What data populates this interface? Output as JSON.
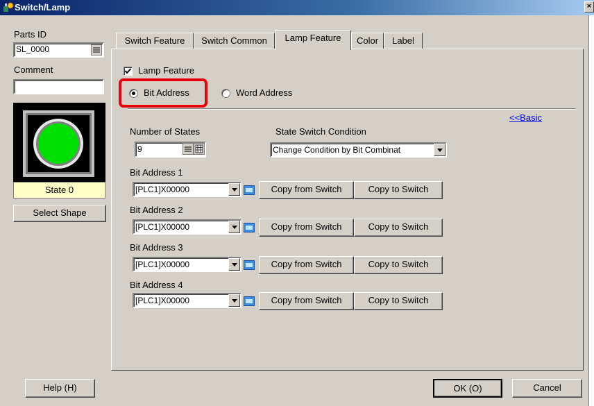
{
  "window": {
    "title": "Switch/Lamp",
    "close_label": "×"
  },
  "left": {
    "parts_id_label": "Parts ID",
    "parts_id_value": "SL_0000",
    "comment_label": "Comment",
    "comment_value": "",
    "state_label": "State 0",
    "select_shape_label": "Select Shape",
    "help_label": "Help (H)"
  },
  "tabs": [
    "Switch Feature",
    "Switch Common",
    "Lamp Feature",
    "Color",
    "Label"
  ],
  "lamp": {
    "lamp_feature_label": "Lamp Feature",
    "bit_address_label": "Bit Address",
    "word_address_label": "Word Address",
    "basic_link": "<<Basic",
    "num_states_label": "Number of States",
    "num_states_value": "9",
    "state_switch_label": "State Switch Condition",
    "state_switch_value": "Change Condition by Bit Combinat",
    "bit_addresses": [
      {
        "label": "Bit Address 1",
        "value": "[PLC1]X00000"
      },
      {
        "label": "Bit Address 2",
        "value": "[PLC1]X00000"
      },
      {
        "label": "Bit Address 3",
        "value": "[PLC1]X00000"
      },
      {
        "label": "Bit Address 4",
        "value": "[PLC1]X00000"
      }
    ],
    "copy_from_label": "Copy from Switch",
    "copy_to_label": "Copy to Switch"
  },
  "footer": {
    "ok_label": "OK (O)",
    "cancel_label": "Cancel"
  },
  "colors": {
    "highlight": "#e8000d",
    "lamp_green": "#00e000",
    "title_blue": "#0a246a"
  }
}
